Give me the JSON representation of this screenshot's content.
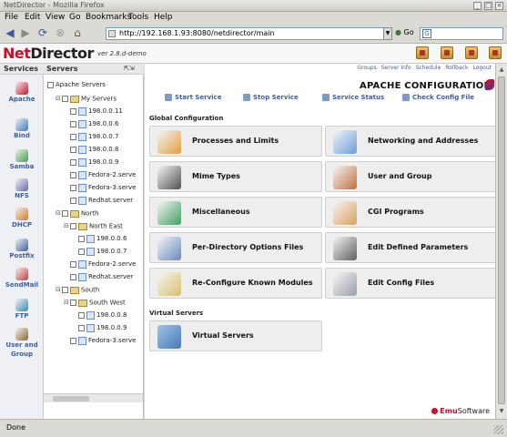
{
  "window": {
    "title": "NetDirector - Mozilla Firefox"
  },
  "menu": [
    "File",
    "Edit",
    "View",
    "Go",
    "Bookmarks",
    "Tools",
    "Help"
  ],
  "browser": {
    "url": "http://192.168.1.93:8080/netdirector/main",
    "go_label": "Go",
    "status": "Done"
  },
  "header": {
    "logo_net": "Net",
    "logo_dir": "Director",
    "version": "ver 2.8.d-demo"
  },
  "left": {
    "services_label": "Services",
    "servers_label": "Servers",
    "services": [
      "Apache",
      "Bind",
      "Samba",
      "NFS",
      "DHCP",
      "Postfix",
      "SendMail",
      "FTP",
      "User and Group"
    ],
    "tree": [
      {
        "label": "Apache Servers",
        "depth": 0,
        "type": "root",
        "toggle": ""
      },
      {
        "label": "My Servers",
        "depth": 1,
        "type": "group",
        "toggle": "⊟"
      },
      {
        "label": "198.0.0.11",
        "depth": 2,
        "type": "host",
        "toggle": ""
      },
      {
        "label": "198.0.0.6",
        "depth": 2,
        "type": "host",
        "toggle": ""
      },
      {
        "label": "198.0.0.7",
        "depth": 2,
        "type": "host",
        "toggle": ""
      },
      {
        "label": "198.0.0.8",
        "depth": 2,
        "type": "host",
        "toggle": ""
      },
      {
        "label": "198.0.0.9",
        "depth": 2,
        "type": "host",
        "toggle": ""
      },
      {
        "label": "Fedora-2.serve",
        "depth": 2,
        "type": "host",
        "toggle": ""
      },
      {
        "label": "Fedora-3.serve",
        "depth": 2,
        "type": "host",
        "toggle": ""
      },
      {
        "label": "Redhat.server",
        "depth": 2,
        "type": "host",
        "toggle": ""
      },
      {
        "label": "North",
        "depth": 1,
        "type": "group",
        "toggle": "⊟"
      },
      {
        "label": "North East",
        "depth": 2,
        "type": "group",
        "toggle": "⊟"
      },
      {
        "label": "198.0.0.6",
        "depth": 3,
        "type": "host",
        "toggle": ""
      },
      {
        "label": "198.0.0.7",
        "depth": 3,
        "type": "host",
        "toggle": ""
      },
      {
        "label": "Fedora-2.serve",
        "depth": 2,
        "type": "host",
        "toggle": ""
      },
      {
        "label": "Redhat.server",
        "depth": 2,
        "type": "host",
        "toggle": ""
      },
      {
        "label": "South",
        "depth": 1,
        "type": "group",
        "toggle": "⊟"
      },
      {
        "label": "South West",
        "depth": 2,
        "type": "group",
        "toggle": "⊟"
      },
      {
        "label": "198.0.0.8",
        "depth": 3,
        "type": "host",
        "toggle": ""
      },
      {
        "label": "198.0.0.9",
        "depth": 3,
        "type": "host",
        "toggle": ""
      },
      {
        "label": "Fedora-3.serve",
        "depth": 2,
        "type": "host",
        "toggle": ""
      }
    ]
  },
  "main": {
    "toplinks": [
      "Groups",
      "Server Info",
      "Schedule",
      "Rollback",
      "Logout"
    ],
    "title": "APACHE CONFIGURATION",
    "actions": [
      "Start Service",
      "Stop Service",
      "Service Status",
      "Check Config File"
    ],
    "global_label": "Global Configuration",
    "cards": [
      "Processes and Limits",
      "Networking and Addresses",
      "Mime Types",
      "User and Group",
      "Miscellaneous",
      "CGI Programs",
      "Per-Directory Options Files",
      "Edit Defined Parameters",
      "Re-Configure Known Modules",
      "Edit Config Files"
    ],
    "virtual_label": "Virtual Servers",
    "virtual_card": "Virtual Servers",
    "brand_emu": "Emu",
    "brand_software": "Software"
  },
  "colors": {
    "accent": "#3b5fa5",
    "logo_red": "#c8102e"
  }
}
